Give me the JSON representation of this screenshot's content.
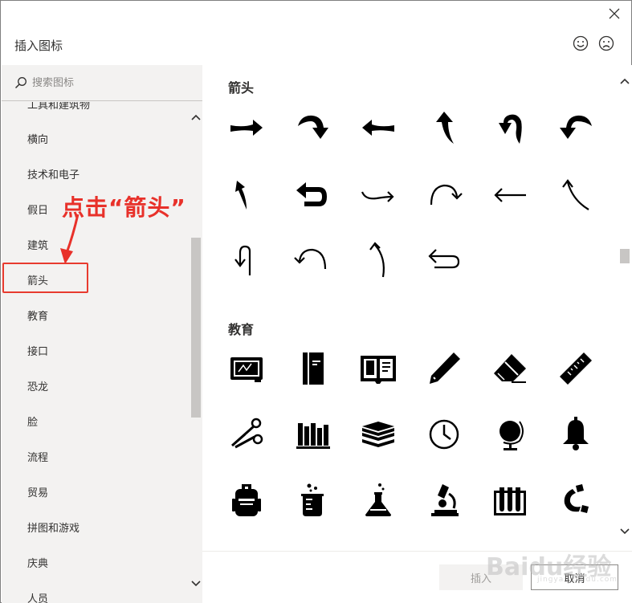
{
  "dialog": {
    "title": "插入图标",
    "close_icon": "close-icon",
    "feedback": {
      "happy_icon": "smile-icon",
      "sad_icon": "frown-icon"
    }
  },
  "search": {
    "placeholder": "搜索图标",
    "icon": "search-icon"
  },
  "categories": [
    "工具和建筑物",
    "横向",
    "技术和电子",
    "假日",
    "建筑",
    "箭头",
    "教育",
    "接口",
    "恐龙",
    "脸",
    "流程",
    "贸易",
    "拼图和游戏",
    "庆典",
    "人员"
  ],
  "sections": {
    "arrows": {
      "title": "箭头",
      "icons": [
        "arrow-right-solid-icon",
        "arrow-curve-down-right-solid-icon",
        "arrow-left-solid-icon",
        "arrow-up-solid-icon",
        "arrow-uturn-left-solid-icon",
        "arrow-curve-down-left-solid-icon",
        "arrow-up-left-solid-icon",
        "arrow-back-solid-icon",
        "arrow-curve-right-line-icon",
        "arrow-rotate-cw-line-icon",
        "arrow-left-line-icon",
        "arrow-curve-up-left-line-icon",
        "arrow-uturn-down-line-icon",
        "arrow-rotate-ccw-line-icon",
        "arrow-curve-up-line-icon",
        "arrow-return-left-line-icon"
      ]
    },
    "education": {
      "title": "教育",
      "icons": [
        "chalkboard-icon",
        "book-closed-icon",
        "book-open-icon",
        "pencil-icon",
        "eraser-icon",
        "ruler-icon",
        "scissors-icon",
        "books-shelf-icon",
        "books-stack-icon",
        "clock-icon",
        "globe-icon",
        "bell-icon",
        "backpack-icon",
        "beaker-icon",
        "flask-icon",
        "microscope-icon",
        "test-tubes-icon",
        "magnet-icon"
      ]
    }
  },
  "footer": {
    "insert_label": "插入",
    "cancel_label": "取消"
  },
  "annotation": {
    "text": "点击“箭头”"
  },
  "watermark": {
    "text": "Baidu经验",
    "sub": "jingyan.baidu.com"
  },
  "colors": {
    "annotation": "#e8312a",
    "sidebar_bg": "#f3f2f1",
    "scroll_thumb": "#c8c6c4"
  }
}
